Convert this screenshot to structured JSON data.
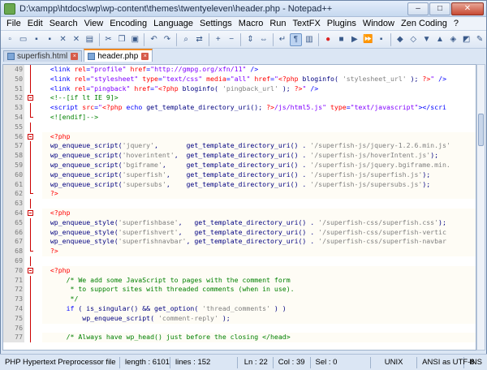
{
  "window": {
    "title": "D:\\xampp\\htdocs\\wp\\wp-content\\themes\\twentyeleven\\header.php - Notepad++",
    "min_label": "–",
    "max_label": "□",
    "close_label": "✕"
  },
  "menu": [
    {
      "label": "File"
    },
    {
      "label": "Edit"
    },
    {
      "label": "Search"
    },
    {
      "label": "View"
    },
    {
      "label": "Encoding"
    },
    {
      "label": "Language"
    },
    {
      "label": "Settings"
    },
    {
      "label": "Macro"
    },
    {
      "label": "Run"
    },
    {
      "label": "TextFX"
    },
    {
      "label": "Plugins"
    },
    {
      "label": "Window"
    },
    {
      "label": "Zen Coding"
    },
    {
      "label": "?"
    }
  ],
  "toolbar_icons": [
    "new-file-icon",
    "open-file-icon",
    "save-icon",
    "save-all-icon",
    "close-icon",
    "close-all-icon",
    "print-icon",
    "sep",
    "cut-icon",
    "copy-icon",
    "paste-icon",
    "sep",
    "undo-icon",
    "redo-icon",
    "sep",
    "find-icon",
    "replace-icon",
    "sep",
    "zoom-in-icon",
    "zoom-out-icon",
    "sep",
    "sync-v-icon",
    "sync-h-icon",
    "sep",
    "word-wrap-icon",
    "all-chars-icon",
    "indent-guide-icon",
    "sep",
    "record-macro-icon",
    "stop-macro-icon",
    "play-macro-icon",
    "run-macro-multiple-icon",
    "save-macro-icon",
    "sep",
    "zen-expand-icon",
    "zen-wrap-icon",
    "zen-next-icon",
    "zen-prev-icon",
    "zen-select-icon",
    "zen-merge-icon",
    "zen-remove-icon"
  ],
  "tabs": [
    {
      "label": "superfish.html",
      "active": false
    },
    {
      "label": "header.php",
      "active": true
    }
  ],
  "editor": {
    "lines": [
      {
        "n": "49",
        "fold": "line",
        "php": false,
        "tokens": [
          [
            "t-def",
            "  "
          ],
          [
            "t-tag",
            "<link "
          ],
          [
            "t-attr",
            "rel"
          ],
          [
            "t-tag",
            "="
          ],
          [
            "t-str",
            "\"profile\""
          ],
          [
            "t-tag",
            " "
          ],
          [
            "t-attr",
            "href"
          ],
          [
            "t-tag",
            "="
          ],
          [
            "t-str",
            "\"http://gmpg.org/xfn/11\""
          ],
          [
            "t-tag",
            " />"
          ]
        ]
      },
      {
        "n": "50",
        "fold": "line",
        "php": false,
        "tokens": [
          [
            "t-def",
            "  "
          ],
          [
            "t-tag",
            "<link "
          ],
          [
            "t-attr",
            "rel"
          ],
          [
            "t-tag",
            "="
          ],
          [
            "t-str",
            "\"stylesheet\""
          ],
          [
            "t-tag",
            " "
          ],
          [
            "t-attr",
            "type"
          ],
          [
            "t-tag",
            "="
          ],
          [
            "t-str",
            "\"text/css\""
          ],
          [
            "t-tag",
            " "
          ],
          [
            "t-attr",
            "media"
          ],
          [
            "t-tag",
            "="
          ],
          [
            "t-str",
            "\"all\""
          ],
          [
            "t-tag",
            " "
          ],
          [
            "t-attr",
            "href"
          ],
          [
            "t-tag",
            "="
          ],
          [
            "t-str",
            "\""
          ],
          [
            "t-php",
            "<?php"
          ],
          [
            "t-fn",
            " bloginfo( "
          ],
          [
            "t-pstr",
            "'stylesheet_url'"
          ],
          [
            "t-fn",
            " ); "
          ],
          [
            "t-php",
            "?>"
          ],
          [
            "t-str",
            "\""
          ],
          [
            "t-tag",
            " />"
          ]
        ]
      },
      {
        "n": "51",
        "fold": "line",
        "php": false,
        "tokens": [
          [
            "t-def",
            "  "
          ],
          [
            "t-tag",
            "<link "
          ],
          [
            "t-attr",
            "rel"
          ],
          [
            "t-tag",
            "="
          ],
          [
            "t-str",
            "\"pingback\""
          ],
          [
            "t-tag",
            " "
          ],
          [
            "t-attr",
            "href"
          ],
          [
            "t-tag",
            "="
          ],
          [
            "t-str",
            "\""
          ],
          [
            "t-php",
            "<?php"
          ],
          [
            "t-fn",
            " bloginfo( "
          ],
          [
            "t-pstr",
            "'pingback_url'"
          ],
          [
            "t-fn",
            " ); "
          ],
          [
            "t-php",
            "?>"
          ],
          [
            "t-str",
            "\""
          ],
          [
            "t-tag",
            " />"
          ]
        ]
      },
      {
        "n": "52",
        "fold": "box",
        "php": false,
        "tokens": [
          [
            "t-def",
            "  "
          ],
          [
            "t-cm",
            "<!--[if lt IE 9]>"
          ]
        ]
      },
      {
        "n": "53",
        "fold": "line",
        "php": false,
        "tokens": [
          [
            "t-def",
            "  "
          ],
          [
            "t-tag",
            "<script "
          ],
          [
            "t-attr",
            "src"
          ],
          [
            "t-tag",
            "="
          ],
          [
            "t-str",
            "\""
          ],
          [
            "t-php",
            "<?php"
          ],
          [
            "t-kw",
            " echo"
          ],
          [
            "t-fn",
            " get_template_directory_uri(); "
          ],
          [
            "t-php",
            "?>"
          ],
          [
            "t-str",
            "/js/html5.js\""
          ],
          [
            "t-tag",
            " "
          ],
          [
            "t-attr",
            "type"
          ],
          [
            "t-tag",
            "="
          ],
          [
            "t-str",
            "\"text/javascript\""
          ],
          [
            "t-tag",
            "></scri"
          ]
        ]
      },
      {
        "n": "54",
        "fold": "end",
        "php": false,
        "tokens": [
          [
            "t-def",
            "  "
          ],
          [
            "t-cm",
            "<![endif]-->"
          ]
        ]
      },
      {
        "n": "55",
        "fold": "line",
        "php": false,
        "tokens": []
      },
      {
        "n": "56",
        "fold": "box",
        "php": true,
        "tokens": [
          [
            "t-def",
            "  "
          ],
          [
            "t-php",
            "<?php"
          ]
        ]
      },
      {
        "n": "57",
        "fold": "line",
        "php": true,
        "tokens": [
          [
            "t-def",
            "  "
          ],
          [
            "t-fn",
            "wp_enqueue_script("
          ],
          [
            "t-pstr",
            "'jquery'"
          ],
          [
            "t-fn",
            ",       get_template_directory_uri() . "
          ],
          [
            "t-pstr",
            "'/superfish-js/jquery-1.2.6.min.js'"
          ]
        ]
      },
      {
        "n": "58",
        "fold": "line",
        "php": true,
        "tokens": [
          [
            "t-def",
            "  "
          ],
          [
            "t-fn",
            "wp_enqueue_script("
          ],
          [
            "t-pstr",
            "'hoverintent'"
          ],
          [
            "t-fn",
            ",  get_template_directory_uri() . "
          ],
          [
            "t-pstr",
            "'/superfish-js/hoverIntent.js'"
          ],
          [
            "t-fn",
            ");"
          ]
        ]
      },
      {
        "n": "59",
        "fold": "line",
        "php": true,
        "tokens": [
          [
            "t-def",
            "  "
          ],
          [
            "t-fn",
            "wp_enqueue_script("
          ],
          [
            "t-pstr",
            "'bgiframe'"
          ],
          [
            "t-fn",
            ",     get_template_directory_uri() . "
          ],
          [
            "t-pstr",
            "'/superfish-js/jquery.bgiframe.min."
          ]
        ]
      },
      {
        "n": "60",
        "fold": "line",
        "php": true,
        "tokens": [
          [
            "t-def",
            "  "
          ],
          [
            "t-fn",
            "wp_enqueue_script("
          ],
          [
            "t-pstr",
            "'superfish'"
          ],
          [
            "t-fn",
            ",    get_template_directory_uri() . "
          ],
          [
            "t-pstr",
            "'/superfish-js/superfish.js'"
          ],
          [
            "t-fn",
            ");"
          ]
        ]
      },
      {
        "n": "61",
        "fold": "line",
        "php": true,
        "tokens": [
          [
            "t-def",
            "  "
          ],
          [
            "t-fn",
            "wp_enqueue_script("
          ],
          [
            "t-pstr",
            "'supersubs'"
          ],
          [
            "t-fn",
            ",    get_template_directory_uri() . "
          ],
          [
            "t-pstr",
            "'/superfish-js/supersubs.js'"
          ],
          [
            "t-fn",
            ");"
          ]
        ]
      },
      {
        "n": "62",
        "fold": "end",
        "php": true,
        "tokens": [
          [
            "t-def",
            "  "
          ],
          [
            "t-php",
            "?>"
          ]
        ]
      },
      {
        "n": "63",
        "fold": "line",
        "php": false,
        "tokens": []
      },
      {
        "n": "64",
        "fold": "box",
        "php": true,
        "tokens": [
          [
            "t-def",
            "  "
          ],
          [
            "t-php",
            "<?php"
          ]
        ]
      },
      {
        "n": "65",
        "fold": "line",
        "php": true,
        "tokens": [
          [
            "t-def",
            "  "
          ],
          [
            "t-fn",
            "wp_enqueue_style("
          ],
          [
            "t-pstr",
            "'superfishbase'"
          ],
          [
            "t-fn",
            ",   get_template_directory_uri() . "
          ],
          [
            "t-pstr",
            "'/superfish-css/superfish.css'"
          ],
          [
            "t-fn",
            ");"
          ]
        ]
      },
      {
        "n": "66",
        "fold": "line",
        "php": true,
        "tokens": [
          [
            "t-def",
            "  "
          ],
          [
            "t-fn",
            "wp_enqueue_style("
          ],
          [
            "t-pstr",
            "'superfishvert'"
          ],
          [
            "t-fn",
            ",   get_template_directory_uri() . "
          ],
          [
            "t-pstr",
            "'/superfish-css/superfish-vertic"
          ]
        ]
      },
      {
        "n": "67",
        "fold": "line",
        "php": true,
        "tokens": [
          [
            "t-def",
            "  "
          ],
          [
            "t-fn",
            "wp_enqueue_style("
          ],
          [
            "t-pstr",
            "'superfishnavbar'"
          ],
          [
            "t-fn",
            ", get_template_directory_uri() . "
          ],
          [
            "t-pstr",
            "'/superfish-css/superfish-navbar"
          ]
        ]
      },
      {
        "n": "68",
        "fold": "end",
        "php": true,
        "tokens": [
          [
            "t-def",
            "  "
          ],
          [
            "t-php",
            "?>"
          ]
        ]
      },
      {
        "n": "69",
        "fold": "line",
        "php": false,
        "tokens": []
      },
      {
        "n": "70",
        "fold": "box",
        "php": true,
        "tokens": [
          [
            "t-def",
            "  "
          ],
          [
            "t-php",
            "<?php"
          ]
        ]
      },
      {
        "n": "71",
        "fold": "line",
        "php": true,
        "tokens": [
          [
            "t-def",
            "      "
          ],
          [
            "t-cm",
            "/* We add some JavaScript to pages with the comment form"
          ]
        ]
      },
      {
        "n": "72",
        "fold": "line",
        "php": true,
        "tokens": [
          [
            "t-def",
            "       "
          ],
          [
            "t-cm",
            "* to support sites with threaded comments (when in use)."
          ]
        ]
      },
      {
        "n": "73",
        "fold": "line",
        "php": true,
        "tokens": [
          [
            "t-def",
            "       "
          ],
          [
            "t-cm",
            "*/"
          ]
        ]
      },
      {
        "n": "74",
        "fold": "line",
        "php": true,
        "tokens": [
          [
            "t-def",
            "      "
          ],
          [
            "t-kw",
            "if"
          ],
          [
            "t-fn",
            " ( is_singular() && get_option( "
          ],
          [
            "t-pstr",
            "'thread_comments'"
          ],
          [
            "t-fn",
            " ) )"
          ]
        ]
      },
      {
        "n": "75",
        "fold": "line",
        "php": true,
        "tokens": [
          [
            "t-def",
            "          "
          ],
          [
            "t-fn",
            "wp_enqueue_script( "
          ],
          [
            "t-pstr",
            "'comment-reply'"
          ],
          [
            "t-fn",
            " );"
          ]
        ]
      },
      {
        "n": "76",
        "fold": "line",
        "php": true,
        "tokens": []
      },
      {
        "n": "77",
        "fold": "line",
        "php": true,
        "tokens": [
          [
            "t-def",
            "      "
          ],
          [
            "t-cm",
            "/* Always have wp_head() just before the closing </head>"
          ]
        ]
      }
    ]
  },
  "status": {
    "lang": "PHP Hypertext Preprocessor file",
    "length": "length : 6101",
    "lines": "lines : 152",
    "ln": "Ln : 22",
    "col": "Col : 39",
    "sel": "Sel : 0",
    "eol": "UNIX",
    "enc": "ANSI as UTF-8",
    "mode": "INS"
  }
}
